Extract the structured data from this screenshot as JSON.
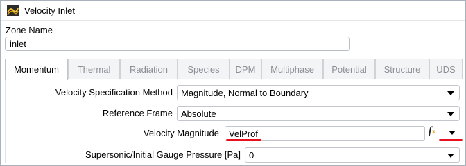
{
  "window": {
    "title": "Velocity Inlet",
    "icon": "fluent-app-icon"
  },
  "zone": {
    "label": "Zone Name",
    "value": "inlet"
  },
  "tabs": [
    {
      "label": "Momentum",
      "active": true
    },
    {
      "label": "Thermal",
      "active": false
    },
    {
      "label": "Radiation",
      "active": false
    },
    {
      "label": "Species",
      "active": false
    },
    {
      "label": "DPM",
      "active": false
    },
    {
      "label": "Multiphase",
      "active": false
    },
    {
      "label": "Potential",
      "active": false
    },
    {
      "label": "Structure",
      "active": false
    },
    {
      "label": "UDS",
      "active": false
    }
  ],
  "momentum": {
    "spec_method": {
      "label": "Velocity Specification Method",
      "value": "Magnitude, Normal to Boundary"
    },
    "ref_frame": {
      "label": "Reference Frame",
      "value": "Absolute"
    },
    "velocity_magnitude": {
      "label": "Velocity Magnitude",
      "value": "VelProf"
    },
    "gauge_pressure": {
      "label": "Supersonic/Initial Gauge Pressure [Pa]",
      "value": "0"
    }
  },
  "colors": {
    "annotation_underline": "#e8101c",
    "fx_accent": "#e0a000"
  }
}
